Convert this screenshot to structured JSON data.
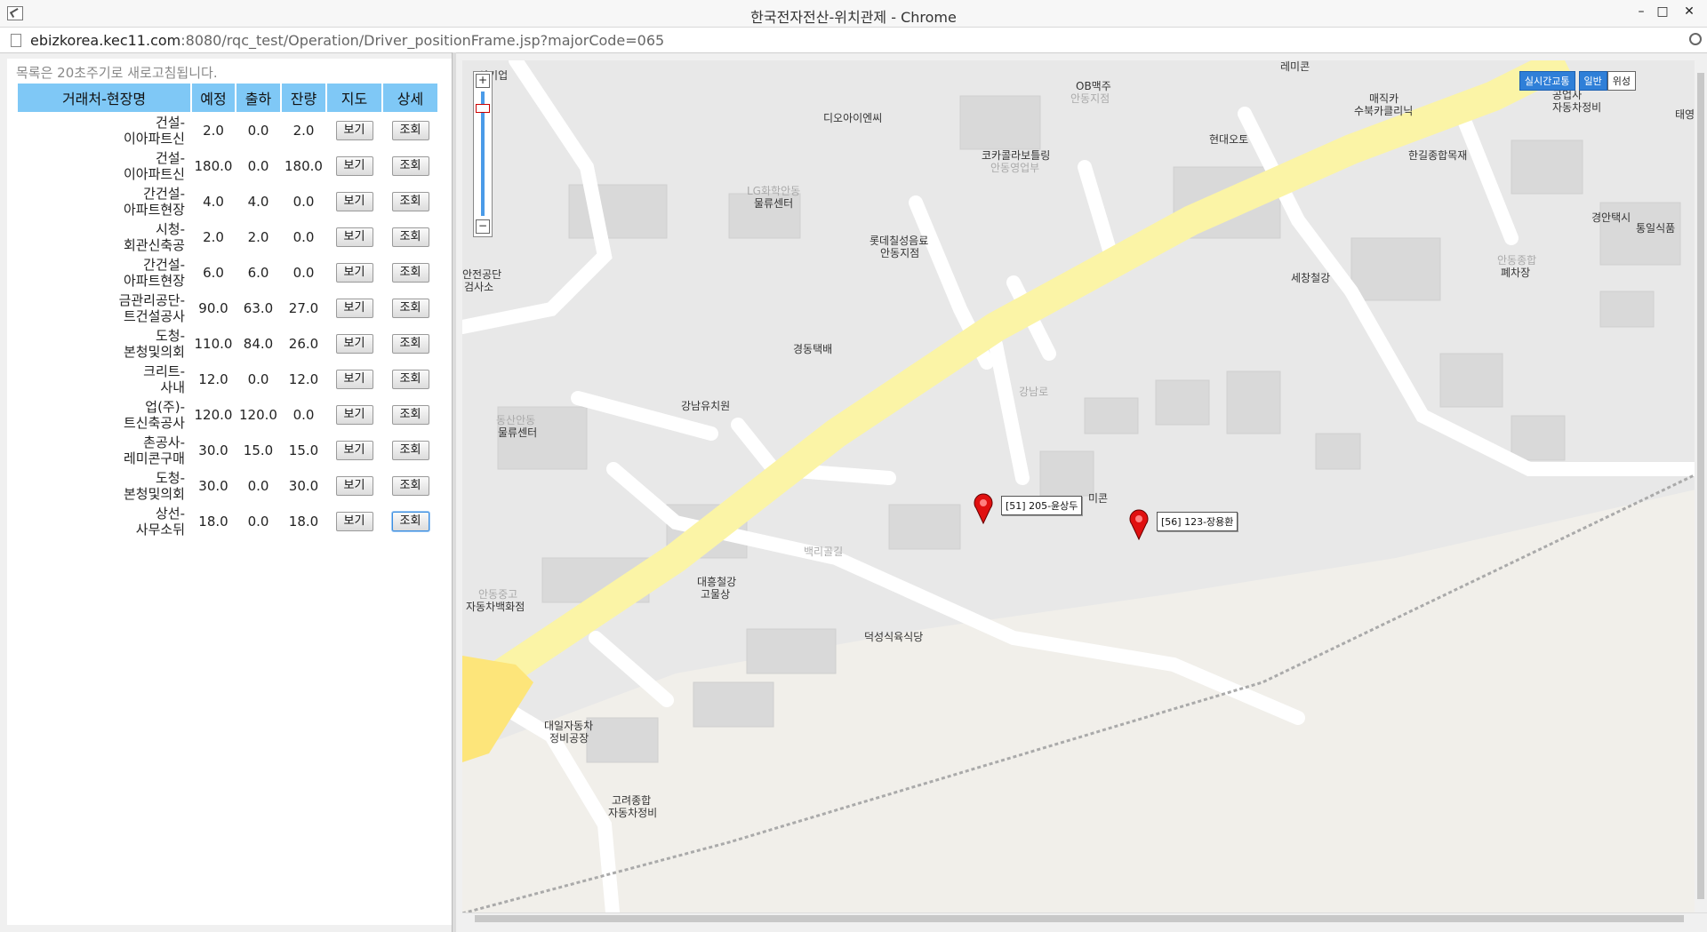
{
  "window": {
    "title": "한국전자전산-위치관제 - Chrome",
    "minimize": "–",
    "maximize": "□",
    "close": "✕"
  },
  "address": {
    "host": "ebizkorea.kec11.com",
    "path": ":8080/rqc_test/Operation/Driver_positionFrame.jsp?majorCode=065"
  },
  "left": {
    "notice": "목록은 20초주기로 새로고침됩니다.",
    "headers": [
      "거래처-현장명",
      "예정",
      "출하",
      "잔량",
      "지도",
      "상세"
    ],
    "view_label": "보기",
    "detail_label": "조회",
    "rows": [
      {
        "line1": "건설-",
        "line2": "이아파트신",
        "plan": "2.0",
        "ship": "0.0",
        "remain": "2.0"
      },
      {
        "line1": "건설-",
        "line2": "이아파트신",
        "plan": "180.0",
        "ship": "0.0",
        "remain": "180.0"
      },
      {
        "line1": "간건설-",
        "line2": "아파트현장",
        "plan": "4.0",
        "ship": "4.0",
        "remain": "0.0"
      },
      {
        "line1": "시청-",
        "line2": "회관신축공",
        "plan": "2.0",
        "ship": "2.0",
        "remain": "0.0"
      },
      {
        "line1": "간건설-",
        "line2": "아파트현장",
        "plan": "6.0",
        "ship": "6.0",
        "remain": "0.0"
      },
      {
        "line1": "금관리공단-",
        "line2": "트건설공사",
        "plan": "90.0",
        "ship": "63.0",
        "remain": "27.0"
      },
      {
        "line1": "도청-",
        "line2": "본청및의회",
        "plan": "110.0",
        "ship": "84.0",
        "remain": "26.0"
      },
      {
        "line1": "크리트-",
        "line2": "사내",
        "plan": "12.0",
        "ship": "0.0",
        "remain": "12.0"
      },
      {
        "line1": "업(주)-",
        "line2": "트신축공사",
        "plan": "120.0",
        "ship": "120.0",
        "remain": "0.0"
      },
      {
        "line1": "촌공사-",
        "line2": "레미콘구매",
        "plan": "30.0",
        "ship": "15.0",
        "remain": "15.0"
      },
      {
        "line1": "도청-",
        "line2": "본청및의회",
        "plan": "30.0",
        "ship": "0.0",
        "remain": "30.0"
      },
      {
        "line1": "상선-",
        "line2": "사무소뒤",
        "plan": "18.0",
        "ship": "0.0",
        "remain": "18.0"
      }
    ]
  },
  "map": {
    "maptype": {
      "traffic": "실시간교통",
      "normal": "일반",
      "satellite": "위성"
    },
    "zoom_in": "+",
    "zoom_out": "−",
    "labels": {
      "l1": "신기업",
      "l2": "레미콘",
      "l3": "OB맥주",
      "l3b": "안동지점",
      "l4": "디오아이엔씨",
      "l5": "매직카",
      "l5b": "수북카클리닉",
      "l6": "공업사",
      "l6b": "자동차정비",
      "l7": "현대오토",
      "l8": "코카콜라보틀링",
      "l8b": "안동영업부",
      "l9": "한길종합목재",
      "l10": "LG화학안동",
      "l10b": "물류센터",
      "l11": "경안택시",
      "l12": "통일식품",
      "l13": "롯데칠성음료",
      "l13b": "안동지점",
      "l14": "안전공단",
      "l14b": "검사소",
      "l15": "세창철강",
      "l16": "안동종합",
      "l16b": "폐차장",
      "l17": "경동택배",
      "l18": "강남유치원",
      "l19": "동산안동",
      "l19b": "물류센터",
      "l20": "대흥철강",
      "l20b": "고물상",
      "l21": "안동중고",
      "l21b": "자동차백화점",
      "l22": "덕성식육식당",
      "l23": "대일자동차",
      "l23b": "정비공장",
      "l24": "고려종합",
      "l24b": "자동차정비",
      "l25": "미콘",
      "l26": "강남로",
      "l27": "백리골길",
      "l28": "태영"
    },
    "markers": [
      {
        "label": "[51] 205-윤상두",
        "color": "#e01010"
      },
      {
        "label": "[56] 123-장용환",
        "color": "#e01010"
      }
    ]
  }
}
